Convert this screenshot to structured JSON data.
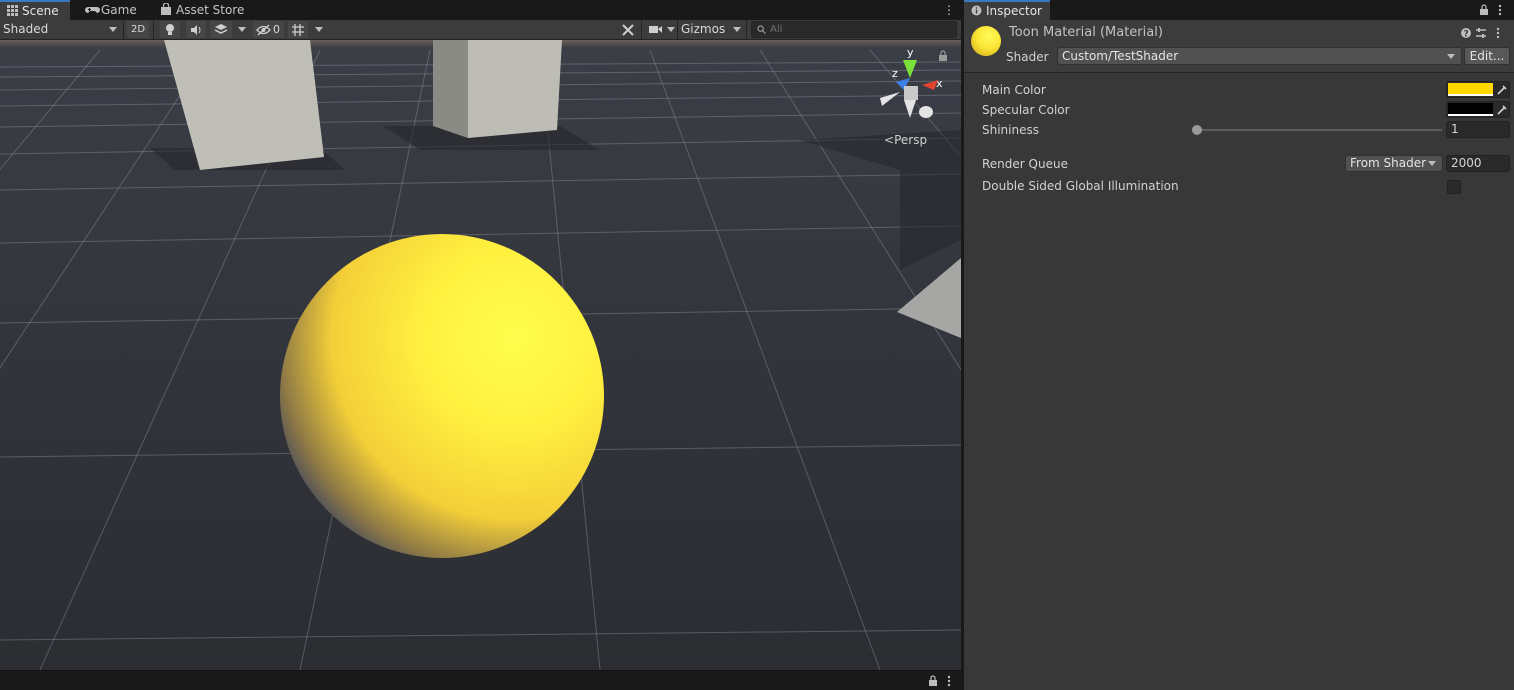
{
  "scene_window": {
    "tabs": [
      {
        "label": "Scene",
        "icon": "grid-icon",
        "active": true
      },
      {
        "label": "Game",
        "icon": "gamepad-icon",
        "active": false
      },
      {
        "label": "Asset Store",
        "icon": "shopping-bag-icon",
        "active": false
      }
    ],
    "toolbar": {
      "draw_mode": "Shaded",
      "mode_2d_label": "2D",
      "hidden_count": "0",
      "gizmos_label": "Gizmos",
      "search_placeholder": "All"
    },
    "viewport": {
      "projection_label": "Persp",
      "axis_x": "x",
      "axis_y": "y",
      "axis_z": "z",
      "sphere_color": "#ffe737"
    }
  },
  "inspector": {
    "tab_label": "Inspector",
    "material_title": "Toon Material (Material)",
    "shader_label": "Shader",
    "shader_value": "Custom/TestShader",
    "edit_label": "Edit...",
    "properties": {
      "main_color_label": "Main Color",
      "main_color": "#ffd800",
      "specular_color_label": "Specular Color",
      "specular_color": "#000000",
      "shininess_label": "Shininess",
      "shininess_value": "1",
      "render_queue_label": "Render Queue",
      "render_queue_mode": "From Shader",
      "render_queue_value": "2000",
      "double_sided_gi_label": "Double Sided Global Illumination",
      "double_sided_gi_checked": false
    }
  },
  "colors": {
    "accent": "#3a79bb",
    "panel": "#383838",
    "toolbar": "#3c3c3c"
  }
}
